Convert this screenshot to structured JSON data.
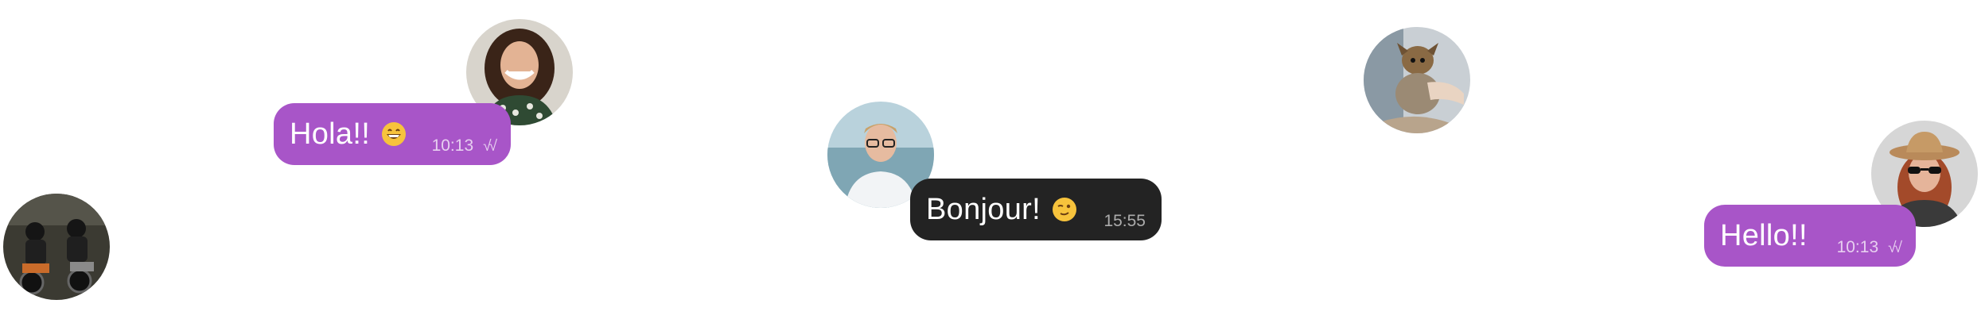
{
  "messages": [
    {
      "text": "Hola!!",
      "emoji": "grinning-face",
      "time": "10:13",
      "status": "√√"
    },
    {
      "text": "Bonjour!",
      "emoji": "winking-face",
      "time": "15:55"
    },
    {
      "text": "Hello!!",
      "time": "10:13",
      "status": "√√"
    }
  ],
  "avatars": [
    {
      "name": "avatar-woman-smiling",
      "description_icon": "portrait"
    },
    {
      "name": "avatar-motorcyclists",
      "description_icon": "portrait"
    },
    {
      "name": "avatar-young-man",
      "description_icon": "portrait"
    },
    {
      "name": "avatar-dog",
      "description_icon": "portrait"
    },
    {
      "name": "avatar-woman-hat",
      "description_icon": "portrait"
    }
  ],
  "colors": {
    "outgoing_bubble": "#a855c8",
    "incoming_bubble": "#232323",
    "bubble_text": "#ffffff"
  }
}
